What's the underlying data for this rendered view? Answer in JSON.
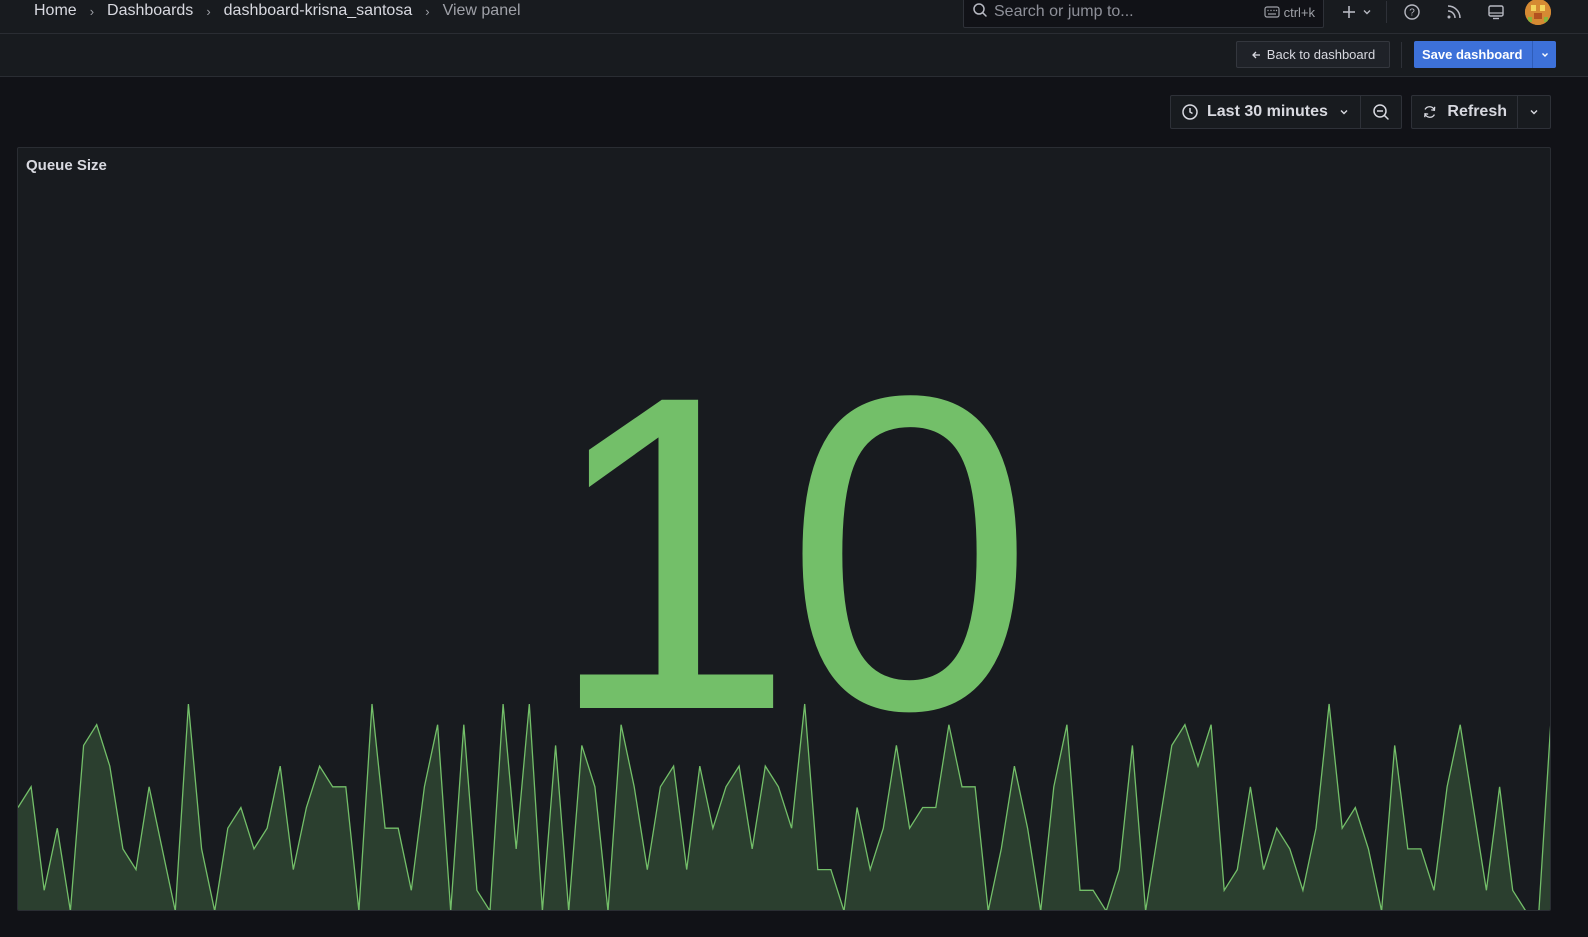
{
  "breadcrumb": {
    "items": [
      "Home",
      "Dashboards",
      "dashboard-krisna_santosa",
      "View panel"
    ]
  },
  "search": {
    "placeholder": "Search or jump to...",
    "shortcut": "ctrl+k"
  },
  "topbar_icons": [
    "plus-icon",
    "chevron-down-icon",
    "help-icon",
    "rss-icon",
    "monitor-icon",
    "avatar"
  ],
  "toolbar": {
    "back_label": "Back to dashboard",
    "save_label": "Save dashboard"
  },
  "time_picker": {
    "label": "Last 30 minutes"
  },
  "refresh": {
    "label": "Refresh"
  },
  "panel": {
    "title": "Queue Size",
    "value": "10",
    "value_color": "#73bf69",
    "sparkline_color": "#73bf69"
  },
  "chart_data": {
    "type": "area",
    "values": [
      5,
      6,
      1,
      4,
      0,
      8,
      9,
      7,
      3,
      2,
      6,
      3,
      0,
      10,
      3,
      0,
      4,
      5,
      3,
      4,
      7,
      2,
      5,
      7,
      6,
      6,
      0,
      10,
      4,
      4,
      1,
      6,
      9,
      0,
      9,
      1,
      0,
      10,
      3,
      10,
      0,
      8,
      0,
      8,
      6,
      0,
      9,
      6,
      2,
      6,
      7,
      2,
      7,
      4,
      6,
      7,
      3,
      7,
      6,
      4,
      10,
      2,
      2,
      0,
      5,
      2,
      4,
      8,
      4,
      5,
      5,
      9,
      6,
      6,
      0,
      3,
      7,
      4,
      0,
      6,
      9,
      1,
      1,
      0,
      2,
      8,
      0,
      4,
      8,
      9,
      7,
      9,
      1,
      2,
      6,
      2,
      4,
      3,
      1,
      4,
      10,
      4,
      5,
      3,
      0,
      8,
      3,
      3,
      1,
      6,
      9,
      5,
      1,
      6,
      1,
      0,
      0,
      10
    ]
  }
}
